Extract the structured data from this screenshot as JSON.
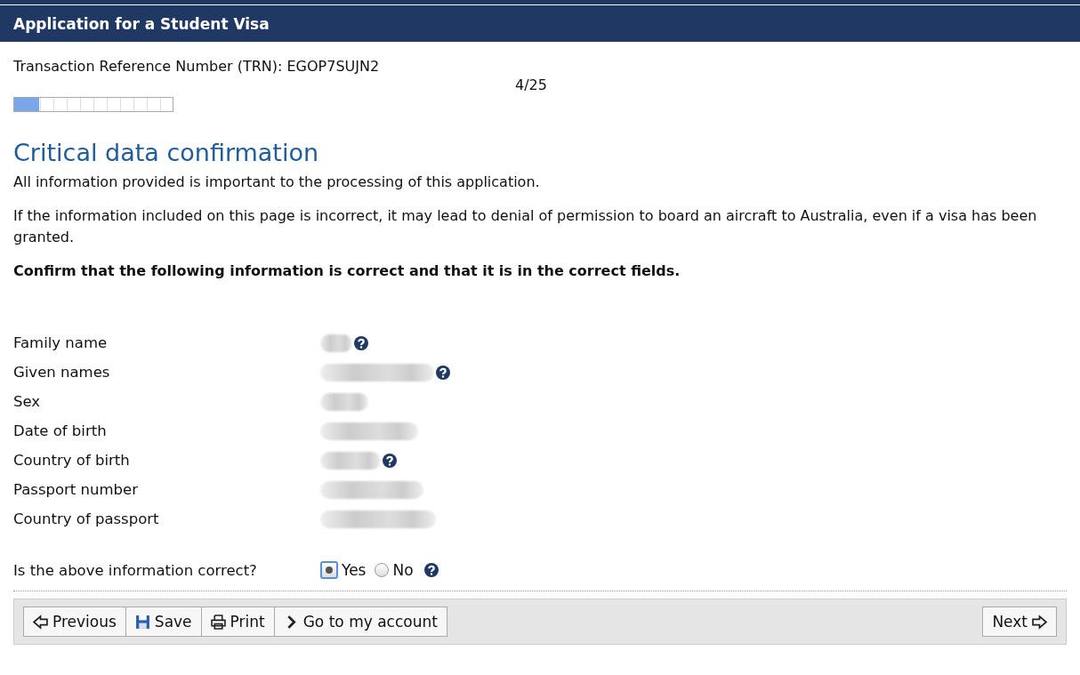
{
  "header": {
    "title": "Application for a Student Visa"
  },
  "trn": "Transaction Reference Number (TRN): EGOP7SUJN2",
  "progress": {
    "label": "4/25",
    "level": 0.16
  },
  "heading": "Critical data confirmation",
  "paragraphs": [
    "All information provided is important to the processing of this application.",
    "If the information included on this page is incorrect, it may lead to denial of permission to board an aircraft to Australia, even if a visa has been granted."
  ],
  "instruction": "Confirm that the following information is correct and that it is in the correct fields.",
  "fields": [
    {
      "label": "Family name",
      "help": true
    },
    {
      "label": "Given names",
      "help": true
    },
    {
      "label": "Sex",
      "help": false
    },
    {
      "label": "Date of birth",
      "help": false
    },
    {
      "label": "Country of birth",
      "help": true
    },
    {
      "label": "Passport number",
      "help": false
    },
    {
      "label": "Country of passport",
      "help": false
    }
  ],
  "question": {
    "label": "Is the above information correct?",
    "options": [
      {
        "label": "Yes",
        "selected": true
      },
      {
        "label": "No",
        "selected": false
      }
    ],
    "help": true
  },
  "buttons_left": [
    {
      "label": "Previous",
      "kind": "previous"
    },
    {
      "label": "Save",
      "kind": "save"
    },
    {
      "label": "Print",
      "kind": "print"
    },
    {
      "label": "Go to my account",
      "kind": "account"
    }
  ],
  "buttons_right": [
    {
      "label": "Next",
      "kind": "next"
    }
  ]
}
